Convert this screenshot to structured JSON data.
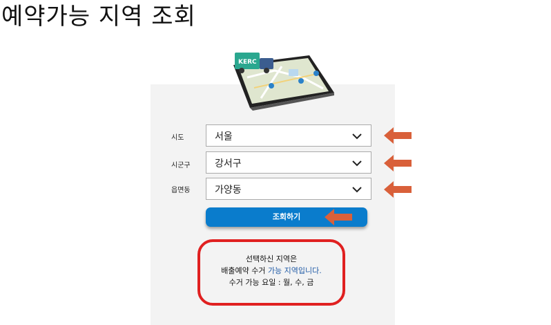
{
  "page": {
    "title": "예약가능 지역 조회"
  },
  "tablet": {
    "badge": "KERC"
  },
  "form": {
    "sido": {
      "label": "시도",
      "value": "서울"
    },
    "sigungu": {
      "label": "시군구",
      "value": "강서구"
    },
    "eupmyeondong": {
      "label": "읍면동",
      "value": "가양동"
    },
    "submit_label": "조회하기"
  },
  "result": {
    "line1": "선택하신 지역은",
    "line2_prefix": "배출예약 수거 ",
    "line2_highlight": "가능 지역입니다.",
    "line3": "수거 가능 요일 : 월, 수, 금"
  },
  "colors": {
    "button": "#0a7ccc",
    "arrow": "#d9603a",
    "highlight_box": "#e02020",
    "link_text": "#1f5aa6"
  }
}
